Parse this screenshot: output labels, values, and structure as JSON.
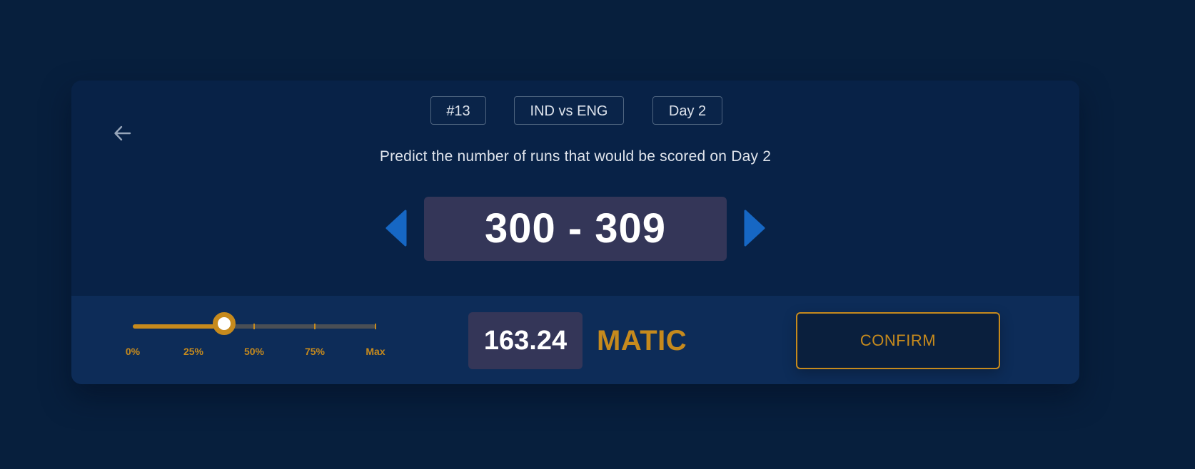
{
  "tags": {
    "round": "#13",
    "match": "IND vs ENG",
    "day": "Day 2"
  },
  "question": "Predict the number of runs that would be scored on Day 2",
  "prediction": {
    "range": "300 - 309"
  },
  "stake_slider": {
    "value_fraction": 0.375,
    "labels": [
      "0%",
      "25%",
      "50%",
      "75%",
      "Max"
    ]
  },
  "stake": {
    "amount": "163.24",
    "currency": "MATIC"
  },
  "confirm_label": "CONFIRM",
  "icons": {
    "back": "arrow-left-icon",
    "decrease": "caret-left-icon",
    "increase": "caret-right-icon"
  },
  "colors": {
    "background": "#071f3d",
    "card": "#082247",
    "card_footer": "#0d2c58",
    "accent": "#c68a1d",
    "arrow": "#1667c4",
    "value_box": "#343658"
  }
}
